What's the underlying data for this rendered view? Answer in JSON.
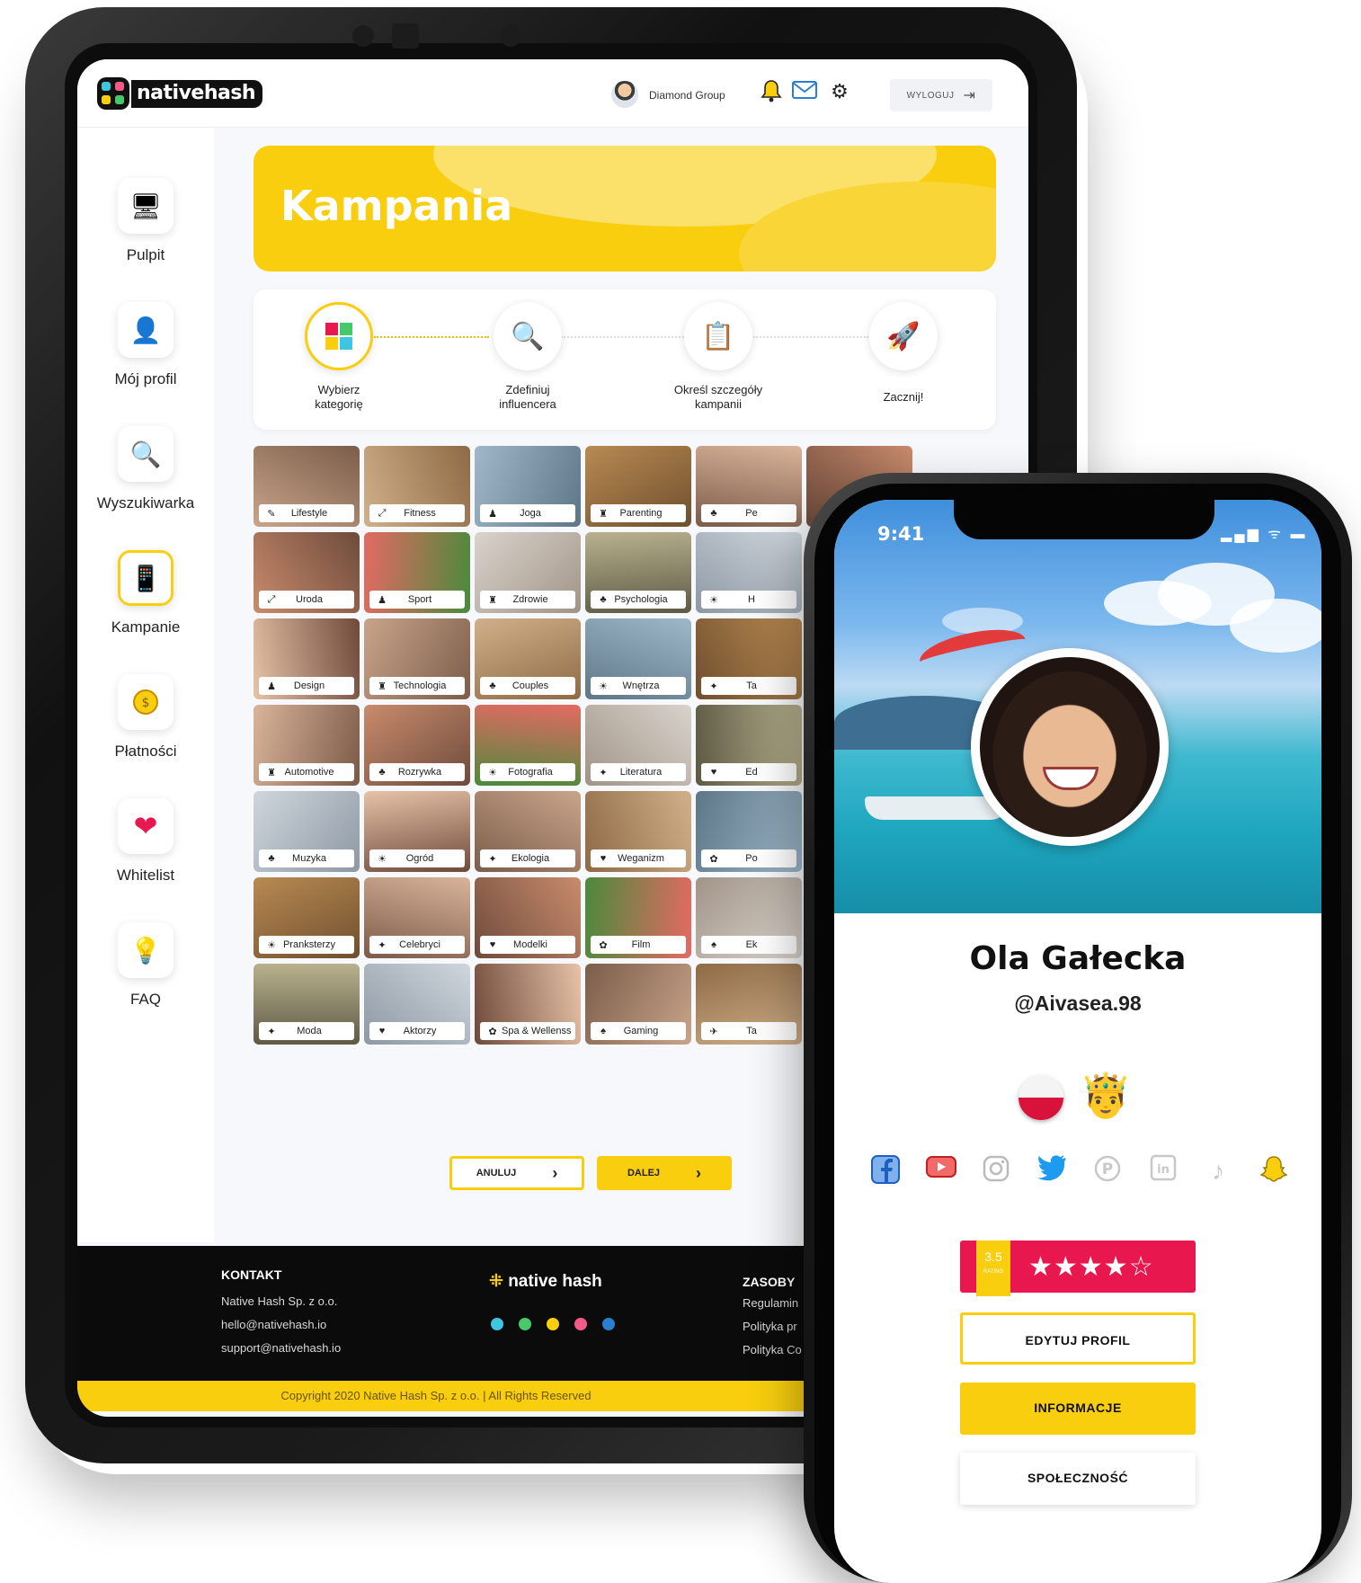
{
  "tablet": {
    "logo_text": "nativehash",
    "user_name": "Diamond Group",
    "logout_label": "WYLOGUJ",
    "sidebar": [
      {
        "label": "Pulpit",
        "icon": "desktop-icon"
      },
      {
        "label": "Mój profil",
        "icon": "profile-icon"
      },
      {
        "label": "Wyszukiwarka",
        "icon": "search-icon"
      },
      {
        "label": "Kampanie",
        "icon": "campaign-icon"
      },
      {
        "label": "Płatności",
        "icon": "coin-icon"
      },
      {
        "label": "Whitelist",
        "icon": "heart-icon"
      },
      {
        "label": "FAQ",
        "icon": "lightbulb-icon"
      }
    ],
    "banner_title": "Kampania",
    "steps": [
      {
        "label": "Wybierz\nkategorię",
        "icon": "categories-icon"
      },
      {
        "label": "Zdefiniuj\ninfluencera",
        "icon": "search-icon"
      },
      {
        "label": "Określ szczegóły\nkampanii",
        "icon": "document-icon"
      },
      {
        "label": "Zacznij!",
        "icon": "rocket-icon"
      }
    ],
    "categories": [
      [
        "Lifestyle",
        "Fitness",
        "Joga",
        "Parenting",
        "Pe",
        ""
      ],
      [
        "Uroda",
        "Sport",
        "Zdrowie",
        "Psychologia",
        "H"
      ],
      [
        "Design",
        "Technologia",
        "Couples",
        "Wnętrza",
        "Ta"
      ],
      [
        "Automotive",
        "Rozrywka",
        "Fotografia",
        "Literatura",
        "Ed"
      ],
      [
        "Muzyka",
        "Ogród",
        "Ekologia",
        "Weganizm",
        "Po"
      ],
      [
        "Pranksterzy",
        "Celebryci",
        "Modelki",
        "Film",
        "Ek"
      ],
      [
        "Moda",
        "Aktorzy",
        "Spa & Wellenss",
        "Gaming",
        "Ta"
      ]
    ],
    "cancel_label": "ANULUJ",
    "next_label": "DALEJ",
    "footer": {
      "contact_heading": "KONTAKT",
      "contact_lines": [
        "Native Hash Sp. z o.o.",
        "hello@nativehash.io",
        "support@nativehash.io"
      ],
      "logo": "native hash",
      "resources_heading": "ZASOBY",
      "resources_lines": [
        "Regulamin",
        "Polityka pr",
        "Polityka Co"
      ],
      "copyright": "Copyright 2020 Native Hash Sp. z o.o. | All Rights Reserved"
    }
  },
  "phone": {
    "time": "9:41",
    "status_icons": "▂▄▆ ᯤ ▬",
    "name": "Ola Gałecka",
    "handle": "@Aivasea.98",
    "rating_value": "3.5",
    "rating_caption": "RATING",
    "rating_stars": "★★★★☆",
    "social_icons": [
      "facebook-icon",
      "youtube-icon",
      "instagram-icon",
      "twitter-icon",
      "pinterest-icon",
      "linkedin-icon",
      "tiktok-icon",
      "snapchat-icon"
    ],
    "buttons": {
      "edit": "EDYTUJ PROFIL",
      "info": "INFORMACJE",
      "community": "SPOŁECZNOŚĆ"
    }
  },
  "colors": {
    "accent": "#f8ce0e",
    "rating": "#e8174e",
    "dark": "#0b0b0b"
  }
}
